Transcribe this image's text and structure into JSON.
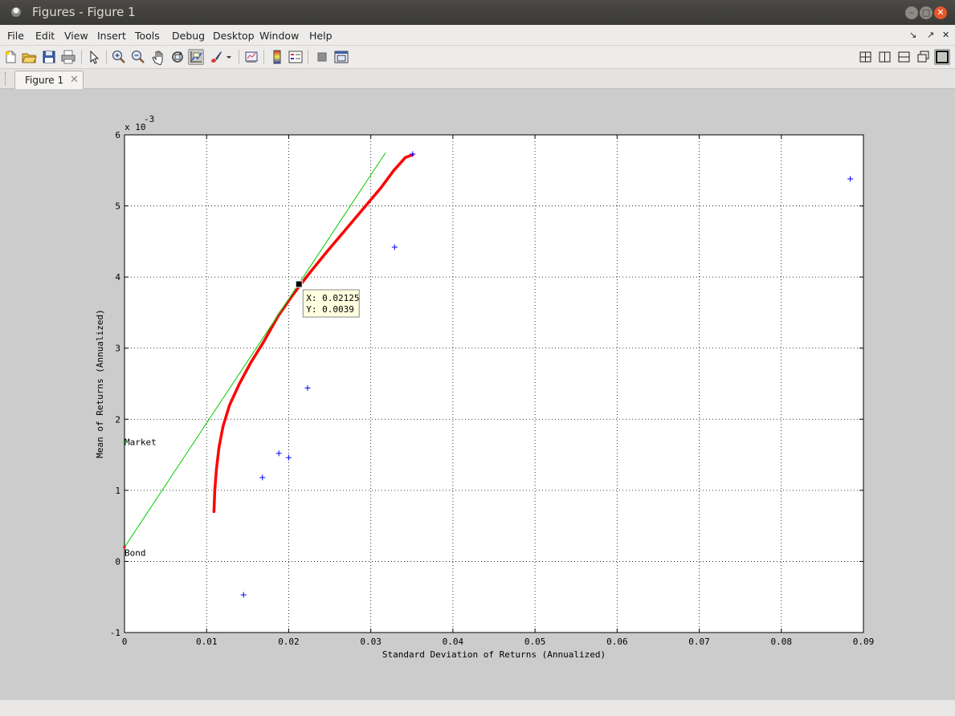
{
  "window": {
    "title": "Figures - Figure 1"
  },
  "menu": [
    "File",
    "Edit",
    "View",
    "Insert",
    "Tools",
    "Debug",
    "Desktop",
    "Window",
    "Help"
  ],
  "menu_right": [
    "↘",
    "↗",
    "✕"
  ],
  "tabs": [
    {
      "label": "Figure 1",
      "close": "✕"
    }
  ],
  "toolbar_icons": [
    "new-figure-icon",
    "open-file-icon",
    "save-icon",
    "print-icon",
    "edit-plot-icon",
    "zoom-in-icon",
    "zoom-out-icon",
    "pan-icon",
    "rotate-3d-icon",
    "data-cursor-icon",
    "brush-icon",
    "brush-dropdown-icon",
    "link-plot-icon",
    "colorbar-icon",
    "legend-icon",
    "hide-plot-tools-icon",
    "show-plot-tools-icon"
  ],
  "layout_icons": [
    "tile-icon",
    "left-right-icon",
    "top-bottom-icon",
    "float-icon",
    "maximize-icon"
  ],
  "colors": {
    "frontier": "#ff0000",
    "cml": "#00cc00",
    "assets": "#0000ff",
    "bond": "#ff0000"
  },
  "datatip": {
    "x_text": "X: 0.02125",
    "y_text": "Y: 0.0039"
  },
  "chart_data": {
    "type": "line",
    "xlabel": "Standard Deviation of Returns (Annualized)",
    "ylabel": "Mean of Returns (Annualized)",
    "y_exponent_label": "x 10",
    "y_exponent_power": "-3",
    "xlim": [
      0,
      0.09
    ],
    "ylim": [
      -1,
      6
    ],
    "y_scale_factor": 0.001,
    "xticks": [
      0,
      0.01,
      0.02,
      0.03,
      0.04,
      0.05,
      0.06,
      0.07,
      0.08,
      0.09
    ],
    "xtick_labels": [
      "0",
      "0.01",
      "0.02",
      "0.03",
      "0.04",
      "0.05",
      "0.06",
      "0.07",
      "0.08",
      "0.09"
    ],
    "yticks": [
      -1,
      0,
      1,
      2,
      3,
      4,
      5,
      6
    ],
    "ytick_labels": [
      "-1",
      "0",
      "1",
      "2",
      "3",
      "4",
      "5",
      "6"
    ],
    "grid": true,
    "series": [
      {
        "kind": "frontier",
        "x": [
          0.0109,
          0.011,
          0.0112,
          0.0115,
          0.012,
          0.0128,
          0.014,
          0.0154,
          0.017,
          0.0187,
          0.0205,
          0.0225,
          0.0246,
          0.0268,
          0.029,
          0.0312,
          0.0328,
          0.0342,
          0.0351
        ],
        "y": [
          0.7,
          1.0,
          1.3,
          1.6,
          1.9,
          2.2,
          2.5,
          2.8,
          3.1,
          3.45,
          3.75,
          4.05,
          4.35,
          4.65,
          4.95,
          5.25,
          5.5,
          5.68,
          5.72
        ]
      },
      {
        "kind": "capital-market-line",
        "x": [
          0,
          0.0318
        ],
        "y": [
          0.2,
          5.75
        ]
      },
      {
        "kind": "assets",
        "x": [
          0.0145,
          0.0168,
          0.0188,
          0.02,
          0.0223,
          0.0329,
          0.0351,
          0.0884
        ],
        "y": [
          -0.47,
          1.18,
          1.52,
          1.46,
          2.44,
          4.42,
          5.73,
          5.38
        ]
      }
    ],
    "annotations": [
      {
        "text": "Market",
        "x": 0,
        "y": 1.68
      },
      {
        "text": "Bond",
        "x": 0,
        "y": 0.2
      }
    ],
    "datatip_point": {
      "x": 0.02125,
      "y": 3.9
    }
  }
}
